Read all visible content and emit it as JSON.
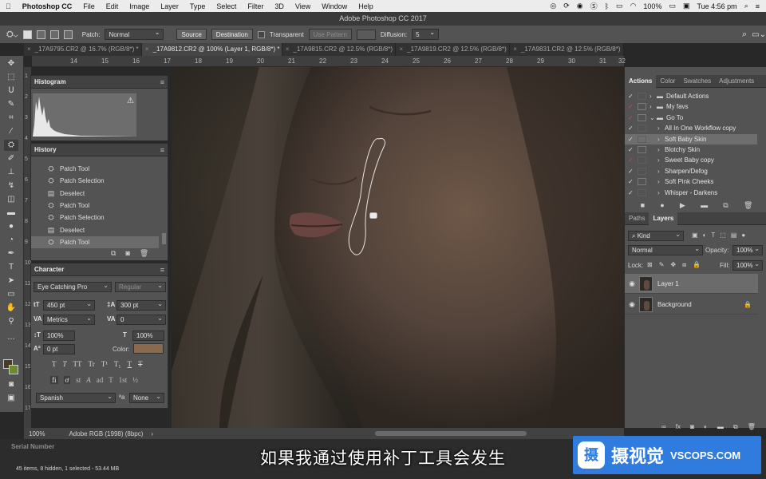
{
  "menubar": {
    "apple": "",
    "app_name": "Photoshop CC",
    "items": [
      "File",
      "Edit",
      "Image",
      "Layer",
      "Type",
      "Select",
      "Filter",
      "3D",
      "View",
      "Window",
      "Help"
    ],
    "battery": "100%",
    "clock": "Tue 4:56 pm"
  },
  "window": {
    "title": "Adobe Photoshop CC 2017"
  },
  "options": {
    "patch_label": "Patch:",
    "patch_mode": "Normal",
    "source": "Source",
    "destination": "Destination",
    "transparent": "Transparent",
    "use_pattern": "Use Pattern",
    "diffusion_label": "Diffusion:",
    "diffusion_value": "5"
  },
  "tabs": [
    {
      "label": "_17A9795.CR2 @ 16.7% (RGB/8*) *"
    },
    {
      "label": "_17A9812.CR2 @ 100% (Layer 1, RGB/8*) *"
    },
    {
      "label": "_17A9815.CR2 @ 12.5% (RGB/8*)"
    },
    {
      "label": "_17A9819.CR2 @ 12.5% (RGB/8*)"
    },
    {
      "label": "_17A9831.CR2 @ 12.5% (RGB/8*)"
    }
  ],
  "ruler_h": [
    "14",
    "15",
    "16",
    "17",
    "18",
    "19",
    "20",
    "21",
    "22",
    "23",
    "24",
    "25",
    "26",
    "27",
    "28",
    "29",
    "30",
    "31",
    "32"
  ],
  "ruler_v": [
    "1",
    "2",
    "3",
    "4",
    "5",
    "6",
    "7",
    "8",
    "9",
    "10",
    "11",
    "12",
    "13",
    "14",
    "15",
    "16",
    "17"
  ],
  "histogram": {
    "title": "Histogram",
    "warning": "⚠"
  },
  "history": {
    "title": "History",
    "items": [
      "Patch Tool",
      "Patch Selection",
      "Deselect",
      "Patch Tool",
      "Patch Selection",
      "Deselect",
      "Patch Tool"
    ],
    "selected_index": 6
  },
  "character": {
    "title": "Character",
    "font_family": "Eye Catching Pro",
    "font_style": "Regular",
    "font_size": "450 pt",
    "leading": "300 pt",
    "kerning": "Metrics",
    "tracking": "0",
    "vscale": "100%",
    "hscale": "100%",
    "baseline": "0 pt",
    "color_label": "Color:",
    "color": "#8a6a4e",
    "language": "Spanish",
    "aa_label": "ªa",
    "antialias": "None",
    "typo_glyphs": [
      "T",
      "T",
      "TT",
      "Tr",
      "T¹",
      "T₁",
      "T",
      "T"
    ],
    "ot_glyphs": [
      "fi",
      "ơ",
      "st",
      "A",
      "ad",
      "T",
      "1st",
      "½"
    ]
  },
  "actions_panel": {
    "tabs": [
      "Actions",
      "Color",
      "Swatches",
      "Adjustments"
    ],
    "rows": [
      {
        "label": "Default Actions",
        "type": "set",
        "check": "✓",
        "red": false,
        "dialog": false,
        "open": false
      },
      {
        "label": "My favs",
        "type": "set",
        "check": "✓",
        "red": true,
        "dialog": true,
        "open": false
      },
      {
        "label": "Go To",
        "type": "set",
        "check": "✓",
        "red": true,
        "dialog": true,
        "open": true
      },
      {
        "label": "All In One Workflow copy",
        "type": "action",
        "check": "✓",
        "red": false,
        "dialog": false,
        "open": false
      },
      {
        "label": "Soft Baby Skin",
        "type": "action",
        "check": "✓",
        "red": false,
        "dialog": false,
        "open": false
      },
      {
        "label": "Blotchy Skin",
        "type": "action",
        "check": "✓",
        "red": false,
        "dialog": true,
        "open": false
      },
      {
        "label": "Sweet Baby copy",
        "type": "action",
        "check": "✓",
        "red": true,
        "dialog": false,
        "open": false
      },
      {
        "label": "Sharpen/Defog",
        "type": "action",
        "check": "✓",
        "red": false,
        "dialog": false,
        "open": false
      },
      {
        "label": "Soft Pink Cheeks",
        "type": "action",
        "check": "✓",
        "red": false,
        "dialog": true,
        "open": false
      },
      {
        "label": "Whisper - Darkens",
        "type": "action",
        "check": "✓",
        "red": false,
        "dialog": false,
        "open": false
      }
    ],
    "selected_index": 4
  },
  "layers_panel": {
    "tabs": [
      "Paths",
      "Layers"
    ],
    "filter": "Kind",
    "blend_mode": "Normal",
    "opacity_label": "Opacity:",
    "opacity": "100%",
    "lock_label": "Lock:",
    "fill_label": "Fill:",
    "fill": "100%",
    "layers": [
      {
        "name": "Layer 1",
        "locked": false
      },
      {
        "name": "Background",
        "locked": true
      }
    ],
    "selected_index": 0
  },
  "status": {
    "zoom": "100%",
    "profile": "Adobe RGB (1998) (8bpc)",
    "arrow": "›"
  },
  "bridge": {
    "serial": "Serial Number",
    "items_info": "45 items, 8 hidden, 1 selected - 53.44 MB"
  },
  "subtitle": "如果我通过使用补丁工具会发生",
  "watermark": {
    "logo": "摄",
    "cn": "摄视觉",
    "en": "VSCOPS.COM"
  }
}
